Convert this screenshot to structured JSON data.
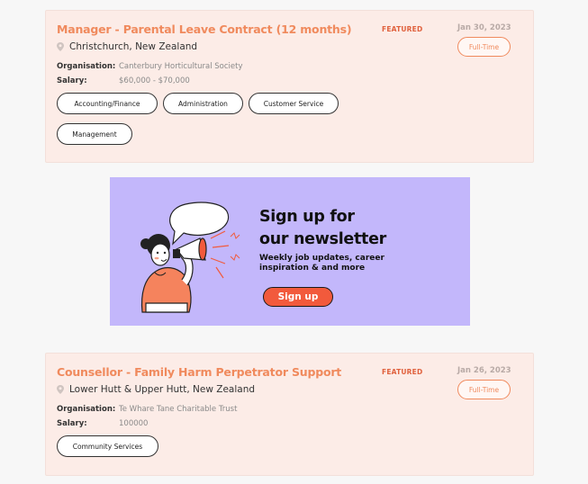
{
  "jobs": [
    {
      "title": "Manager - Parental Leave Contract (12 months)",
      "featured": "FEATURED",
      "date": "Jan 30, 2023",
      "type": "Full-Time",
      "location": "Christchurch, New Zealand",
      "org_label": "Organisation:",
      "org": "Canterbury Horticultural Society",
      "salary_label": "Salary:",
      "salary": "$60,000 - $70,000",
      "tags": [
        "Accounting/Finance",
        "Administration",
        "Customer Service",
        "Management"
      ]
    },
    {
      "title": "Counsellor - Family Harm Perpetrator Support",
      "featured": "FEATURED",
      "date": "Jan 26, 2023",
      "type": "Full-Time",
      "location": "Lower Hutt & Upper Hutt, New Zealand",
      "org_label": "Organisation:",
      "org": "Te Whare Tane Charitable Trust",
      "salary_label": "Salary:",
      "salary": "100000",
      "tags": [
        "Community Services"
      ]
    }
  ],
  "newsletter": {
    "heading_line1": "Sign up for",
    "heading_line2": "our newsletter",
    "sub_line1": "Weekly job updates, career",
    "sub_line2": "inspiration & and more",
    "button": "Sign up"
  },
  "colors": {
    "accent": "#f08a5d",
    "card_bg": "#fcece7",
    "banner_bg": "#c3b7fb",
    "button": "#f25a3c"
  },
  "icons": {
    "location": "map-pin-icon",
    "illustration": "megaphone-woman-illustration"
  }
}
